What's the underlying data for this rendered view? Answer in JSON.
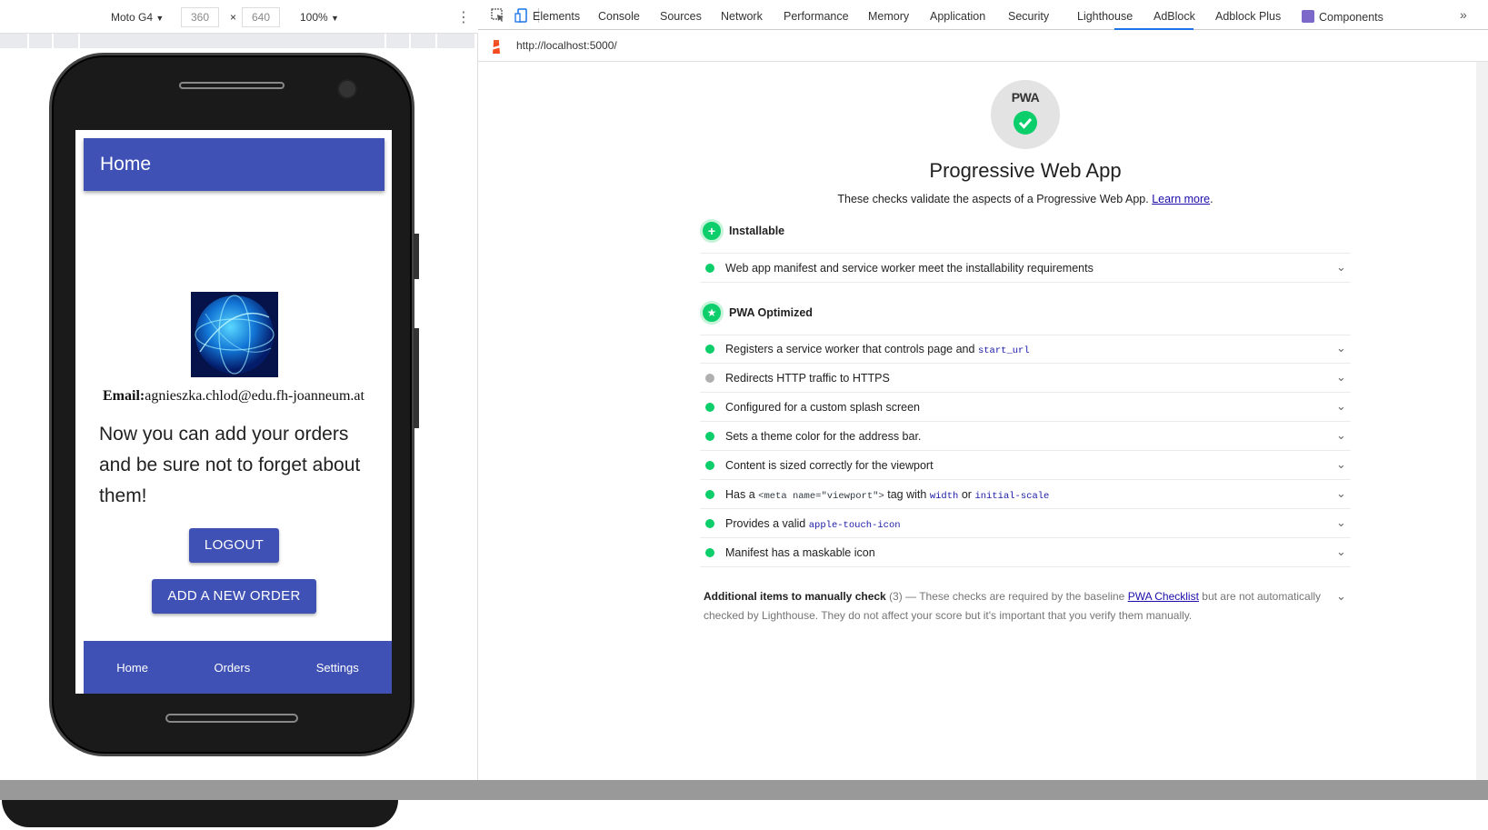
{
  "device_toolbar": {
    "device": "Moto G4",
    "width": "360",
    "times": "×",
    "height": "640",
    "zoom": "100%",
    "dropdown_arrow": "▼",
    "menu_icon": "⋮"
  },
  "phone_app": {
    "header_title": "Home",
    "email_label": "Email:",
    "email_value": "agnieszka.chlod@edu.fh-joanneum.at",
    "welcome_text": "Now you can add your orders and be sure not to forget about them!",
    "logout_button": "LOGOUT",
    "add_order_button": "ADD A NEW ORDER",
    "bottom_nav": [
      "Home",
      "Orders",
      "Settings"
    ],
    "accent_color": "#3f51b5"
  },
  "devtools": {
    "tabs": [
      {
        "label": "Elements"
      },
      {
        "label": "Console"
      },
      {
        "label": "Sources"
      },
      {
        "label": "Network"
      },
      {
        "label": "Performance"
      },
      {
        "label": "Memory"
      },
      {
        "label": "Application"
      },
      {
        "label": "Security"
      },
      {
        "label": "Lighthouse",
        "active": true
      },
      {
        "label": "AdBlock"
      },
      {
        "label": "Adblock Plus"
      },
      {
        "label": "Components"
      }
    ],
    "more_tabs": "»",
    "url": "http://localhost:5000/"
  },
  "report": {
    "gauge_label": "PWA",
    "category_title": "Progressive Web App",
    "description": "These checks validate the aspects of a Progressive Web App.",
    "learn_more": "Learn more",
    "installable": {
      "title": "Installable",
      "audits": [
        "Web app manifest and service worker meet the installability requirements"
      ]
    },
    "optimized": {
      "title": "PWA Optimized",
      "audits": {
        "a1": "Registers a service worker that controls page and",
        "a1_code": "start_url",
        "a2": "Redirects HTTP traffic to HTTPS",
        "a3": "Configured for a custom splash screen",
        "a4": "Sets a theme color for the address bar.",
        "a5": "Content is sized correctly for the viewport",
        "a6_pre": "Has a",
        "a6_code": "<meta name=\"viewport\">",
        "a6_mid": "tag with",
        "a6_code2": "width",
        "a6_or": "or",
        "a6_code3": "initial-scale",
        "a7": "Provides a valid",
        "a7_code": "apple-touch-icon",
        "a8": "Manifest has a maskable icon"
      }
    },
    "manual": {
      "title": "Additional items to manually check",
      "count": "(3)",
      "dash": "—",
      "text1": "These checks are required by the baseline",
      "link": "PWA Checklist",
      "text2": "but are not automatically checked by Lighthouse. They do not affect your score but it's important that you verify them manually."
    },
    "pass_color": "#0cce6b",
    "na_color": "#b0b0b0"
  }
}
